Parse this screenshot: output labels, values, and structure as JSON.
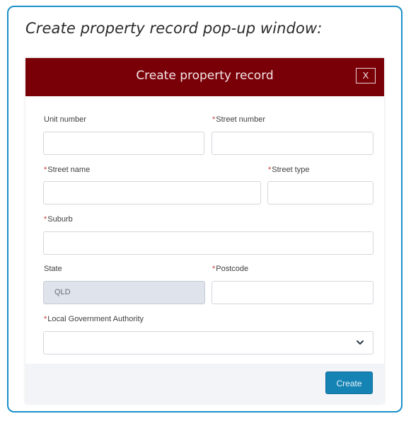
{
  "caption": "Create property record pop-up window:",
  "dialog": {
    "title": "Create property record",
    "close_label": "X"
  },
  "form": {
    "required_marker": "*",
    "unit_number": {
      "label": "Unit number",
      "value": ""
    },
    "street_number": {
      "label": "Street number",
      "value": ""
    },
    "street_name": {
      "label": "Street name",
      "value": ""
    },
    "street_type": {
      "label": "Street type",
      "value": ""
    },
    "suburb": {
      "label": "Suburb",
      "value": ""
    },
    "state": {
      "label": "State",
      "value": "QLD"
    },
    "postcode": {
      "label": "Postcode",
      "value": ""
    },
    "lga": {
      "label": "Local Government Authority",
      "value": ""
    }
  },
  "footer": {
    "create_label": "Create"
  },
  "colors": {
    "header": "#7a0008",
    "callout_border": "#1a8fc8",
    "button": "#1583b4",
    "required": "#c23934"
  }
}
